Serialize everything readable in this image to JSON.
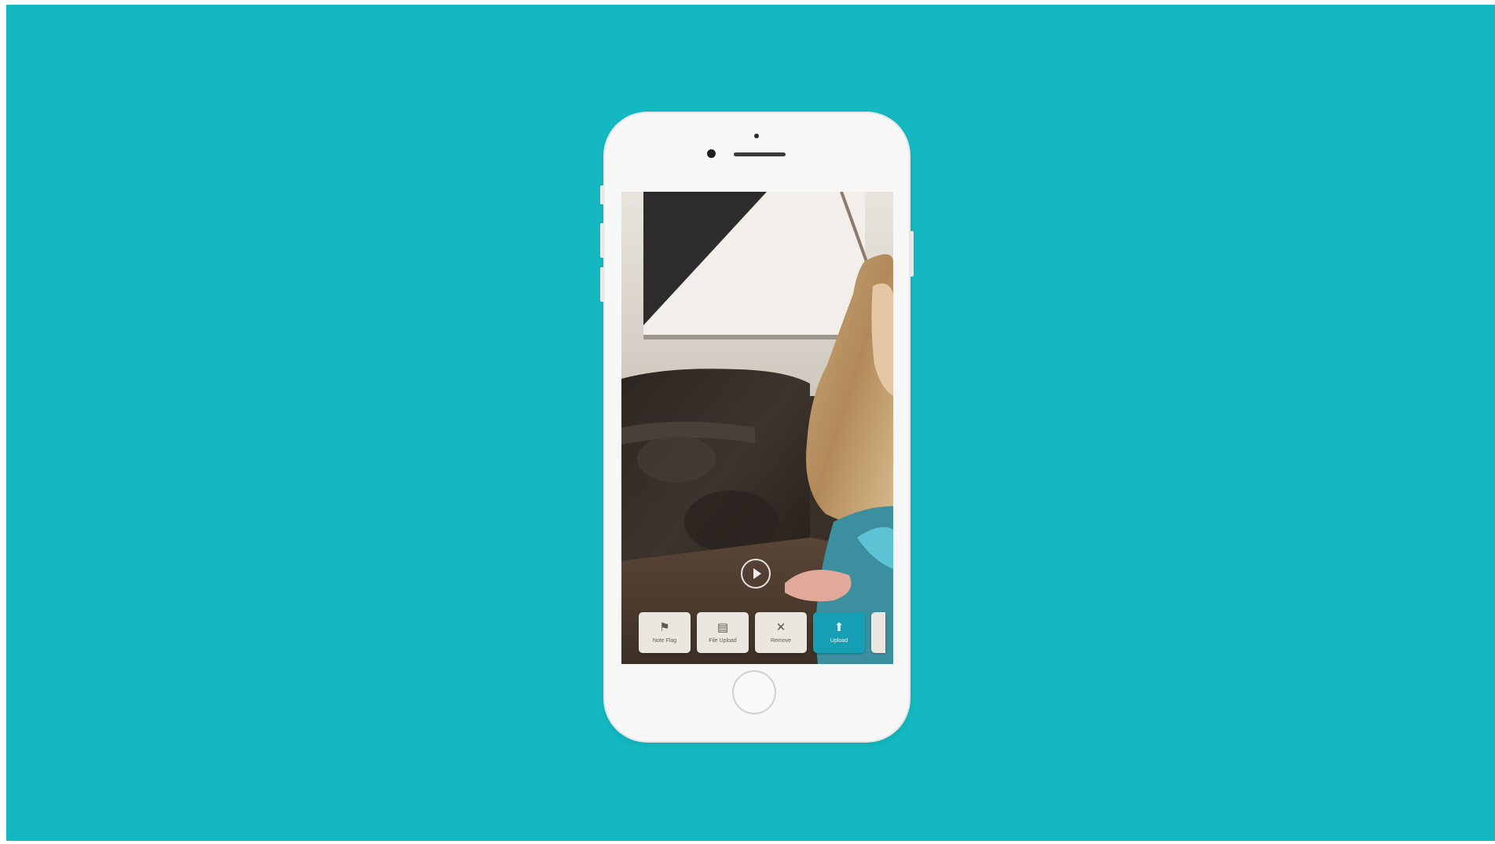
{
  "colors": {
    "background": "#13b8c0",
    "phone_body": "#f7f7f8",
    "primary_action": "#169fb4",
    "secondary_action": "#ebe6df"
  },
  "screen": {
    "top_left_icon": "menu-icon",
    "play_button_icon": "play-icon"
  },
  "actions": [
    {
      "icon_name": "flag-icon",
      "glyph": "⚑",
      "label": "Note Flag"
    },
    {
      "icon_name": "document-icon",
      "glyph": "▤",
      "label": "File Upload"
    },
    {
      "icon_name": "close-icon",
      "glyph": "✕",
      "label": "Remove"
    },
    {
      "icon_name": "upload-icon",
      "glyph": "⬆",
      "label": "Upload"
    }
  ]
}
